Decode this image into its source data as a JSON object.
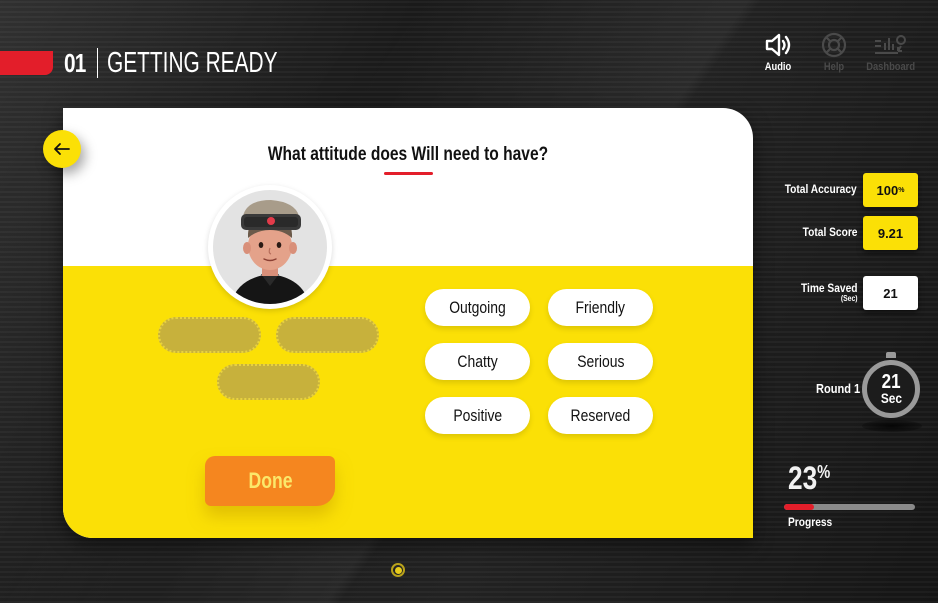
{
  "header": {
    "section_number": "01",
    "section_title": "GETTING READY",
    "nav": [
      {
        "icon": "speaker-icon",
        "label": "Audio",
        "active": true
      },
      {
        "icon": "lifebuoy-icon",
        "label": "Help",
        "active": false
      },
      {
        "icon": "dashboard-icon",
        "label": "Dashboard",
        "active": false
      }
    ]
  },
  "activity": {
    "back_icon": "arrow-left-icon",
    "question": "What attitude does Will need to have?",
    "avatar_alt": "Will character avatar",
    "answer_slots": 3,
    "options": [
      "Outgoing",
      "Friendly",
      "Chatty",
      "Serious",
      "Positive",
      "Reserved"
    ],
    "done_label": "Done"
  },
  "stats": {
    "accuracy_label": "Total Accuracy",
    "accuracy_value": "100",
    "accuracy_unit": "%",
    "score_label": "Total Score",
    "score_value": "9.21",
    "time_saved_label": "Time Saved",
    "time_saved_unit_label": "(Sec)",
    "time_saved_value": "21",
    "round_label": "Round 1",
    "timer_value": "21",
    "timer_unit": "Sec",
    "progress_value": "23",
    "progress_unit": "%",
    "progress_fraction": 0.23,
    "progress_label": "Progress"
  },
  "colors": {
    "accent_red": "#e31e2a",
    "accent_yellow": "#fbe006",
    "done_orange": "#f5861f"
  },
  "pagination": {
    "current": 1,
    "total": 1
  }
}
